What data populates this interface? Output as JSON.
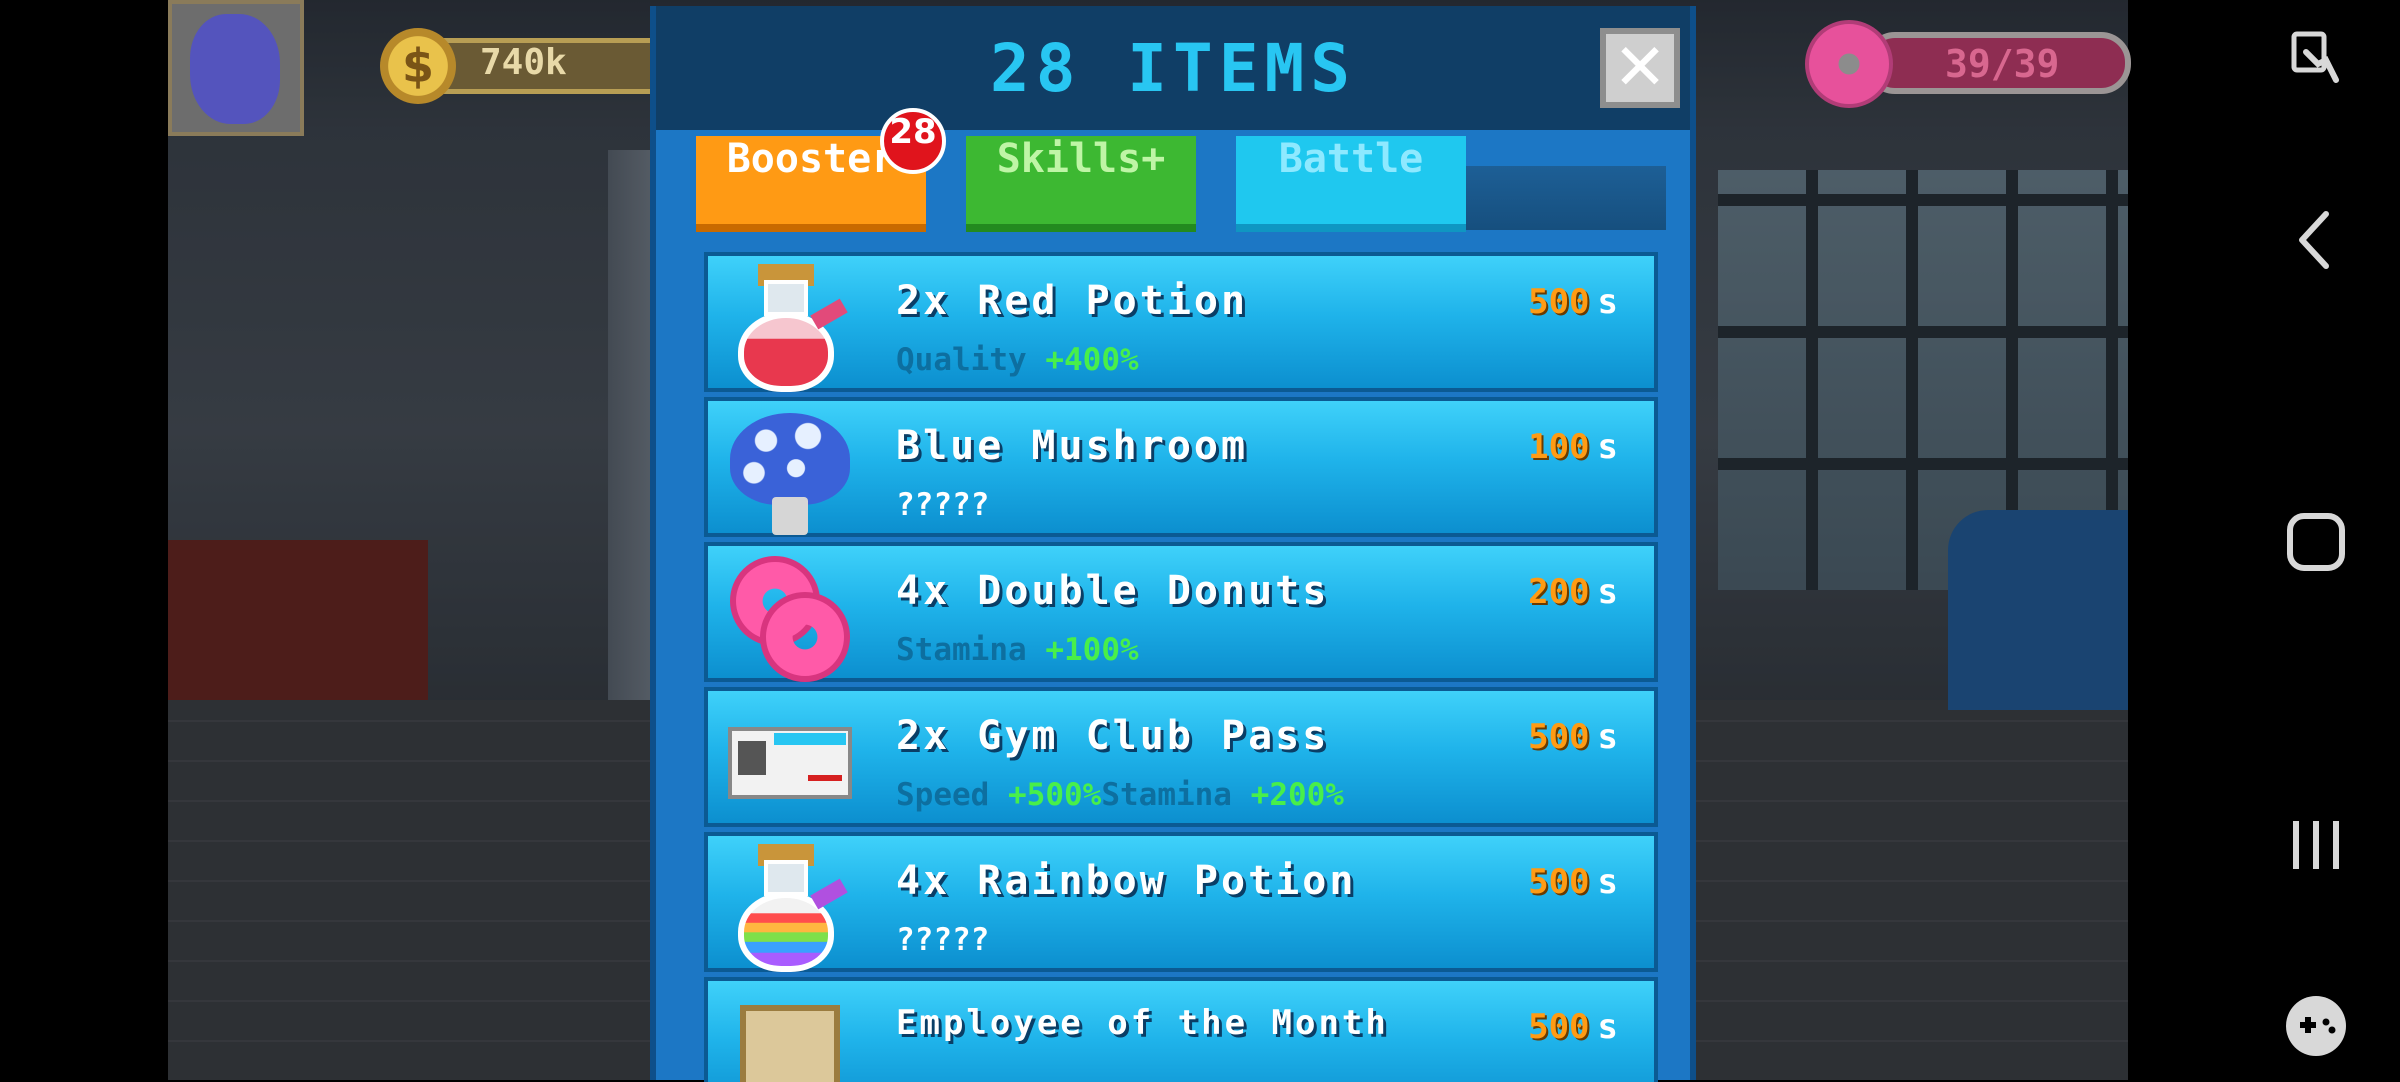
{
  "hud": {
    "coins": "740k",
    "coin_symbol": "$",
    "stamina": "39/39"
  },
  "modal": {
    "title": "28 ITEMS",
    "close_label": "✕",
    "tabs": [
      {
        "label": "Booster",
        "badge": "28",
        "active": true,
        "color": "#ff9a14"
      },
      {
        "label": "Skills+",
        "active": false,
        "color": "#3db832"
      },
      {
        "label": "Battle",
        "active": false,
        "color": "#1fc8ef"
      }
    ],
    "items": [
      {
        "name": "2x Red Potion",
        "price": "500",
        "unit": "s",
        "icon": "red-potion-icon",
        "stats": [
          {
            "label": "Quality",
            "value": "+400%"
          }
        ]
      },
      {
        "name": "Blue Mushroom",
        "price": "100",
        "unit": "s",
        "icon": "blue-mushroom-icon",
        "description": "?????"
      },
      {
        "name": "4x Double Donuts",
        "price": "200",
        "unit": "s",
        "icon": "donut-icon",
        "stats": [
          {
            "label": "Stamina",
            "value": "+100%"
          }
        ]
      },
      {
        "name": "2x Gym Club Pass",
        "price": "500",
        "unit": "s",
        "icon": "gym-pass-icon",
        "stats": [
          {
            "label": "Speed",
            "value": "+500%"
          },
          {
            "label": "Stamina",
            "value": "+200%"
          }
        ]
      },
      {
        "name": "4x Rainbow Potion",
        "price": "500",
        "unit": "s",
        "icon": "rainbow-potion-icon",
        "description": "?????"
      },
      {
        "name": "Employee of the Month",
        "price": "500",
        "unit": "s",
        "icon": "employee-frame-icon"
      }
    ]
  },
  "navbar": {
    "icons": [
      "screenshot-icon",
      "back-icon",
      "home-icon",
      "recents-icon",
      "game-controller-icon"
    ]
  },
  "colors": {
    "accent_title": "#28c6f2",
    "price_orange": "#ff9b14",
    "stat_green": "#48ef4a",
    "badge_red": "#e0141c"
  }
}
